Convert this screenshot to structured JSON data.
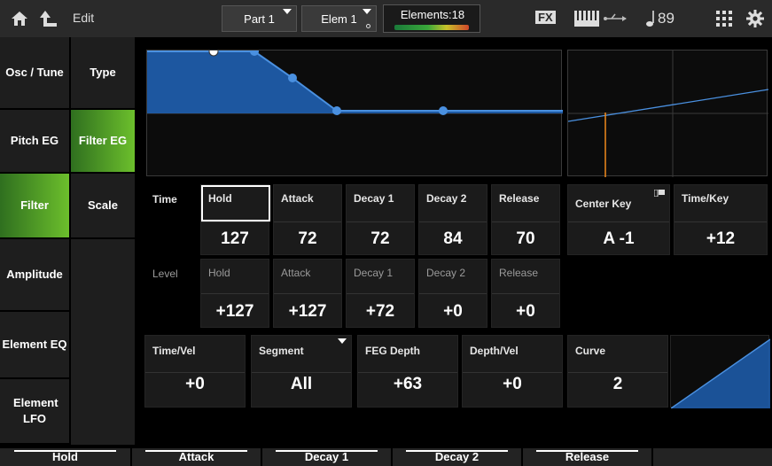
{
  "topbar": {
    "title": "Edit",
    "part_label": "Part 1",
    "elem_label": "Elem 1",
    "elements_label": "Elements:18",
    "fx_label": "FX",
    "tempo": "89"
  },
  "sidebar_left": [
    "Osc / Tune",
    "Pitch EG",
    "Filter",
    "Amplitude",
    "Element EQ",
    "Element LFO"
  ],
  "sidebar_right": [
    "Type",
    "Filter EG",
    "Scale"
  ],
  "time_row": {
    "row_label": "Time",
    "cells": [
      {
        "label": "Hold",
        "value": "127"
      },
      {
        "label": "Attack",
        "value": "72"
      },
      {
        "label": "Decay 1",
        "value": "72"
      },
      {
        "label": "Decay 2",
        "value": "84"
      },
      {
        "label": "Release",
        "value": "70"
      }
    ]
  },
  "level_row": {
    "row_label": "Level",
    "cells": [
      {
        "label": "Hold",
        "value": "+127"
      },
      {
        "label": "Attack",
        "value": "+127"
      },
      {
        "label": "Decay 1",
        "value": "+72"
      },
      {
        "label": "Decay 2",
        "value": "+0"
      },
      {
        "label": "Release",
        "value": "+0"
      }
    ]
  },
  "center_key": {
    "label": "Center Key",
    "value": "A -1"
  },
  "time_key": {
    "label": "Time/Key",
    "value": "+12"
  },
  "bottom_params": [
    {
      "label": "Time/Vel",
      "value": "+0"
    },
    {
      "label": "Segment",
      "value": "All"
    },
    {
      "label": "FEG Depth",
      "value": "+63"
    },
    {
      "label": "Depth/Vel",
      "value": "+0"
    },
    {
      "label": "Curve",
      "value": "2"
    }
  ],
  "bottom_tabs": [
    "Hold",
    "Attack",
    "Decay 1",
    "Decay 2",
    "Release"
  ],
  "colors": {
    "accent": "#6cbf2c",
    "graph_fill": "#1f5fb0",
    "graph_line": "#4a90e0",
    "key_line": "#f08a1c"
  }
}
